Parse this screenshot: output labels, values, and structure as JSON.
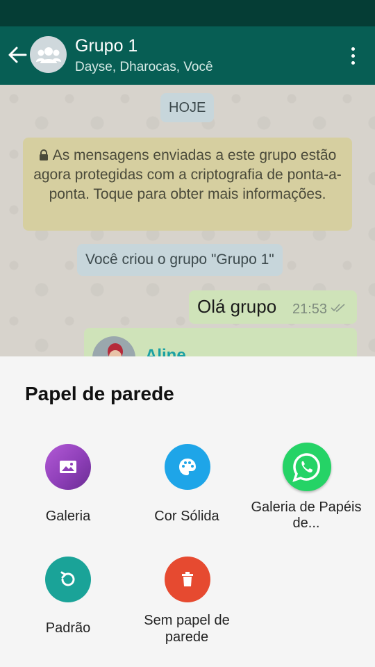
{
  "header": {
    "title": "Grupo 1",
    "subtitle": "Dayse, Dharocas, Você"
  },
  "chat": {
    "date_chip": "HOJE",
    "encryption_notice": "As mensagens enviadas a este grupo estão agora protegidas com a criptografia de ponta-a-ponta. Toque para obter mais informações.",
    "system_message": "Você criou o grupo \"Grupo 1\"",
    "outgoing_message": {
      "text": "Olá grupo",
      "time": "21:53"
    },
    "incoming_sender": "Aline"
  },
  "sheet": {
    "title": "Papel de parede",
    "options": [
      {
        "label": "Galeria",
        "icon": "image-icon",
        "color": "#8e3fb8"
      },
      {
        "label": "Cor Sólida",
        "icon": "palette-icon",
        "color": "#1ea5e8"
      },
      {
        "label": "Galeria de Papéis de...",
        "icon": "whatsapp-icon",
        "color": "#25d366"
      },
      {
        "label": "Padrão",
        "icon": "restore-icon",
        "color": "#1aa398"
      },
      {
        "label": "Sem papel de parede",
        "icon": "trash-icon",
        "color": "#e64a30"
      }
    ]
  },
  "colors": {
    "status_bar": "#053d35",
    "app_bar": "#075e54",
    "outgoing_bubble": "#cfe3b9",
    "notice_bubble": "#d6cfa0"
  }
}
